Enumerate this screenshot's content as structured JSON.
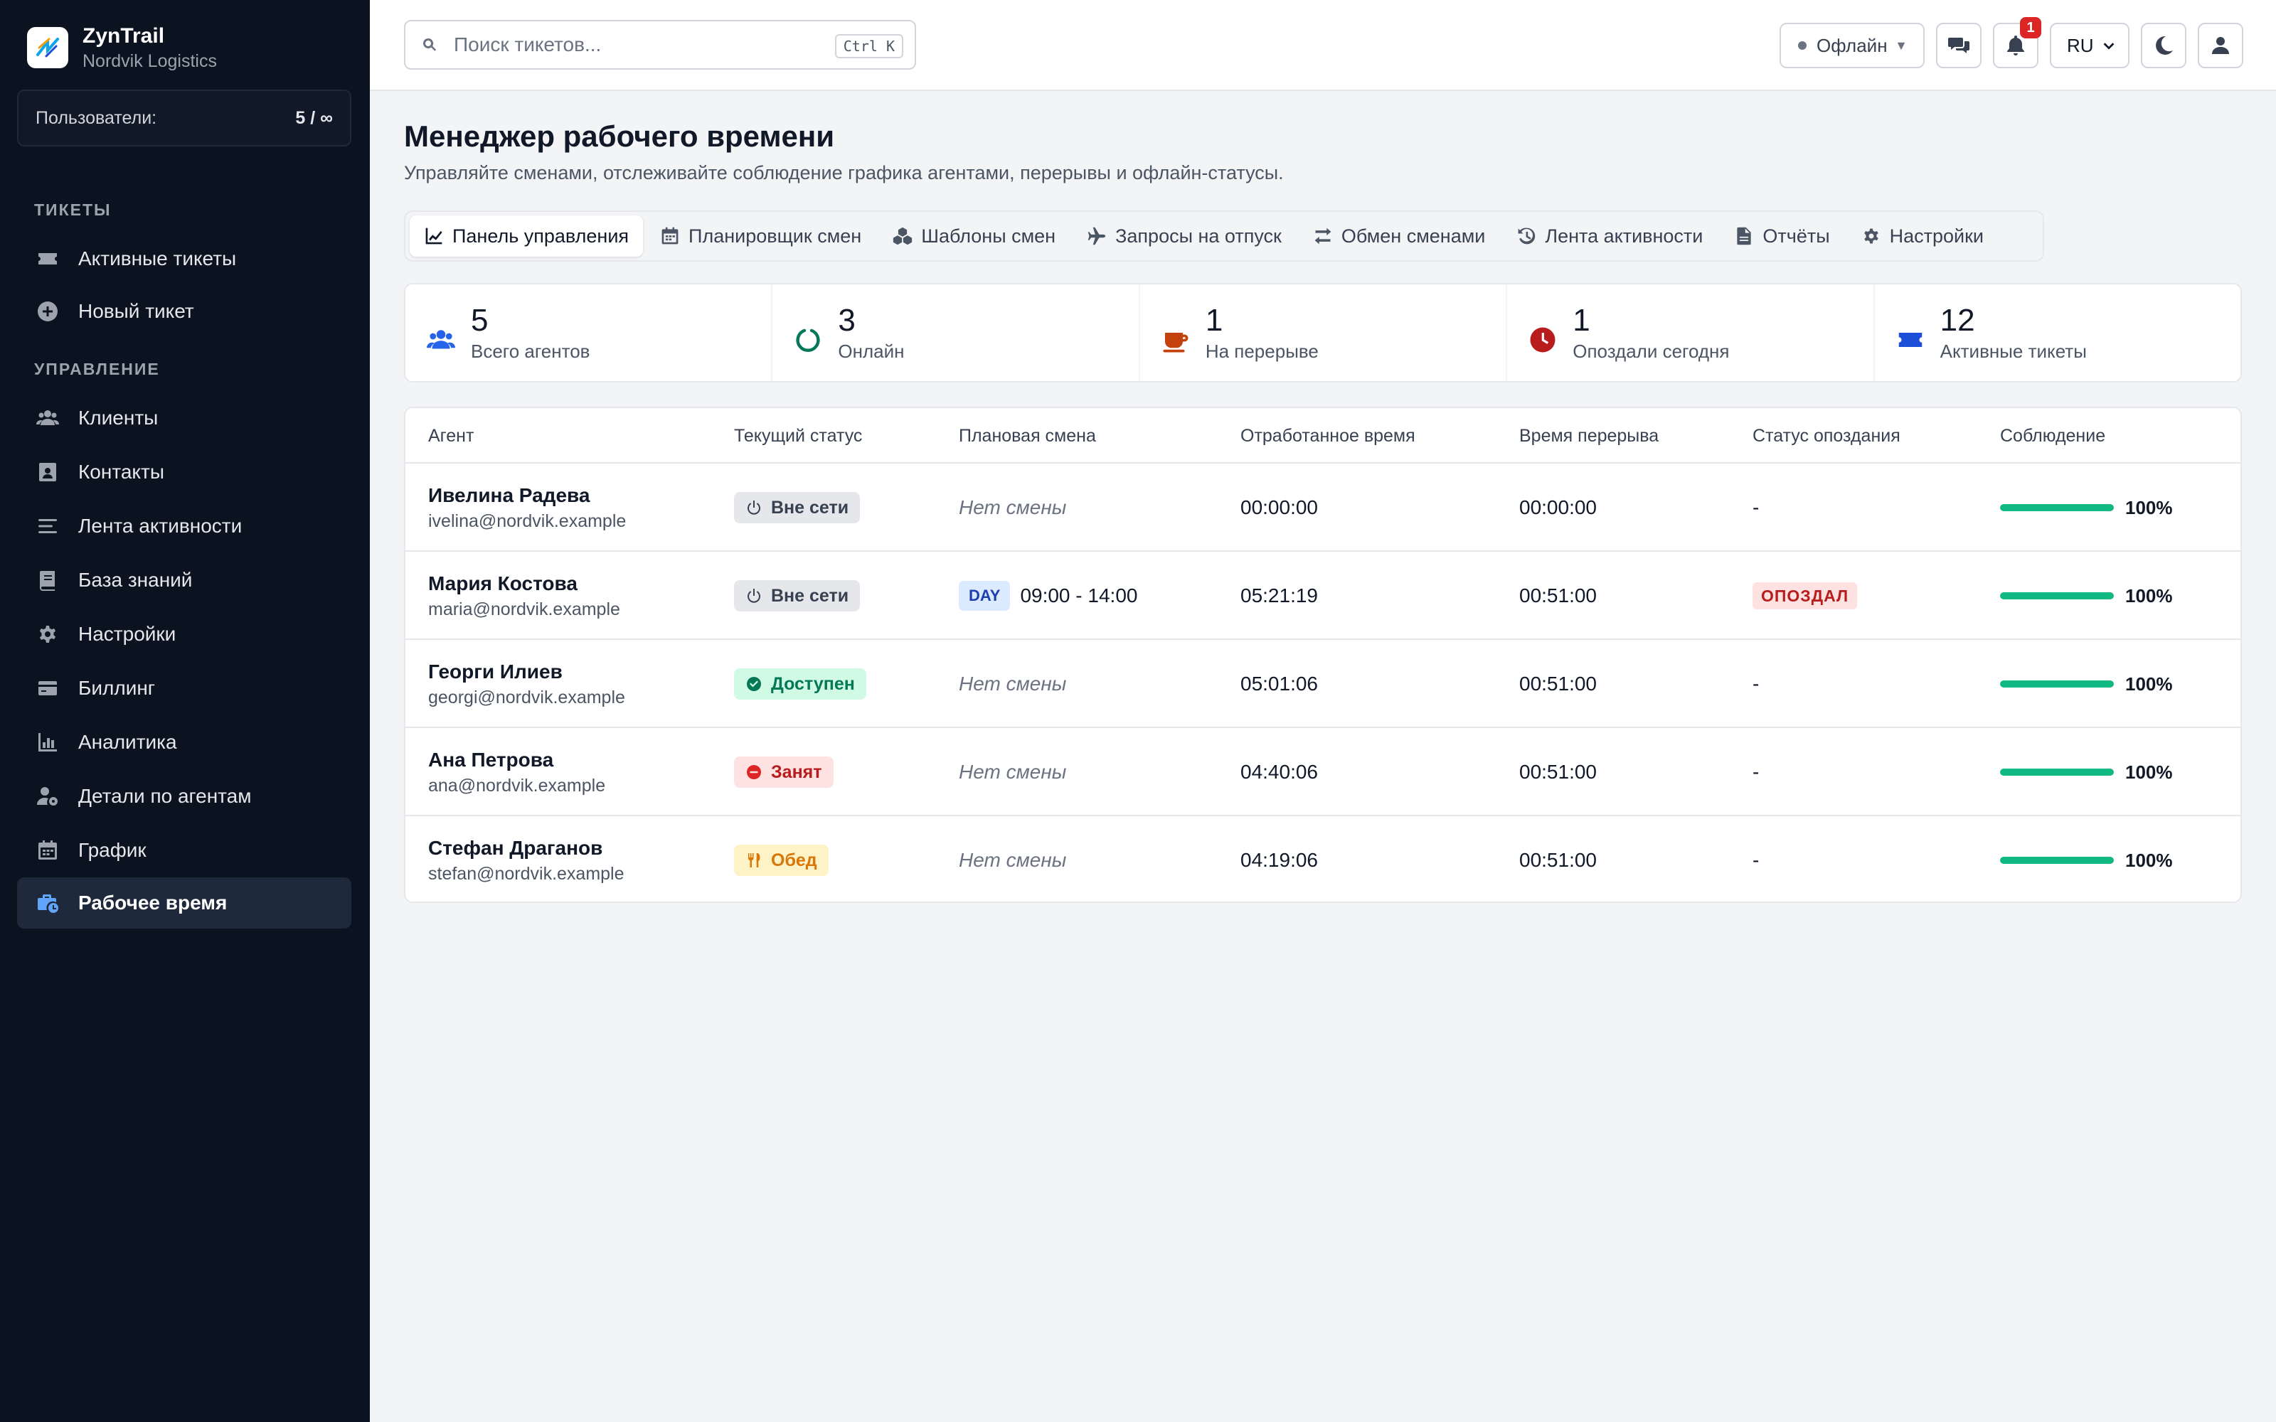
{
  "brand": {
    "name": "ZynTrail",
    "org": "Nordvik Logistics"
  },
  "users": {
    "label": "Пользователи:",
    "count": "5 / ∞"
  },
  "sidebar": {
    "section_tickets": "ТИКЕТЫ",
    "section_management": "УПРАВЛЕНИЕ",
    "tickets": [
      {
        "label": "Активные тикеты",
        "icon": "ticket-icon"
      },
      {
        "label": "Новый тикет",
        "icon": "plus-circle-icon"
      }
    ],
    "management": [
      {
        "label": "Клиенты",
        "icon": "users-icon"
      },
      {
        "label": "Контакты",
        "icon": "contact-card-icon"
      },
      {
        "label": "Лента активности",
        "icon": "list-icon"
      },
      {
        "label": "База знаний",
        "icon": "book-icon"
      },
      {
        "label": "Настройки",
        "icon": "gear-icon"
      },
      {
        "label": "Биллинг",
        "icon": "credit-card-icon"
      },
      {
        "label": "Аналитика",
        "icon": "chart-icon"
      },
      {
        "label": "Детали по агентам",
        "icon": "user-gear-icon"
      },
      {
        "label": "График",
        "icon": "calendar-icon"
      },
      {
        "label": "Рабочее время",
        "icon": "business-time-icon",
        "active": true
      }
    ]
  },
  "topbar": {
    "search_placeholder": "Поиск тикетов...",
    "search_shortcut": "Ctrl K",
    "status_value": "Офлайн",
    "notifications_count": "1",
    "language": "RU"
  },
  "page": {
    "title": "Менеджер рабочего времени",
    "subtitle": "Управляйте сменами, отслеживайте соблюдение графика агентами, перерывы и офлайн-статусы."
  },
  "tabs": [
    {
      "label": "Панель управления",
      "icon": "chart-line-icon",
      "active": true
    },
    {
      "label": "Планировщик смен",
      "icon": "calendar-icon"
    },
    {
      "label": "Шаблоны смен",
      "icon": "cubes-icon"
    },
    {
      "label": "Запросы на отпуск",
      "icon": "plane-icon"
    },
    {
      "label": "Обмен сменами",
      "icon": "swap-icon"
    },
    {
      "label": "Лента активности",
      "icon": "history-icon"
    },
    {
      "label": "Отчёты",
      "icon": "file-icon"
    },
    {
      "label": "Настройки",
      "icon": "gear-icon"
    }
  ],
  "stats": [
    {
      "value": "5",
      "label": "Всего агентов",
      "icon": "users-icon",
      "color": "#2563eb"
    },
    {
      "value": "3",
      "label": "Онлайн",
      "icon": "circle-notch-icon",
      "color": "#047857"
    },
    {
      "value": "1",
      "label": "На перерыве",
      "icon": "coffee-icon",
      "color": "#c2410c"
    },
    {
      "value": "1",
      "label": "Опоздали сегодня",
      "icon": "clock-icon",
      "color": "#b91c1c"
    },
    {
      "value": "12",
      "label": "Активные тикеты",
      "icon": "ticket-icon",
      "color": "#1d4ed8"
    }
  ],
  "table": {
    "headers": [
      "Агент",
      "Текущий статус",
      "Плановая смена",
      "Отработанное время",
      "Время перерыва",
      "Статус опоздания",
      "Соблюдение"
    ],
    "rows": [
      {
        "name": "Ивелина Радева",
        "email": "ivelina@nordvik.example",
        "status": "Вне сети",
        "status_type": "offline",
        "shift_tag": "",
        "shift": "Нет смены",
        "worked": "00:00:00",
        "break": "00:00:00",
        "late": "-",
        "compliance": "100%",
        "compliance_value": 1.0
      },
      {
        "name": "Мария Костова",
        "email": "maria@nordvik.example",
        "status": "Вне сети",
        "status_type": "offline",
        "shift_tag": "DAY",
        "shift": "09:00 - 14:00",
        "worked": "05:21:19",
        "break": "00:51:00",
        "late": "ОПОЗДАЛ",
        "compliance": "100%",
        "compliance_value": 1.0
      },
      {
        "name": "Георги Илиев",
        "email": "georgi@nordvik.example",
        "status": "Доступен",
        "status_type": "available",
        "shift_tag": "",
        "shift": "Нет смены",
        "worked": "05:01:06",
        "break": "00:51:00",
        "late": "-",
        "compliance": "100%",
        "compliance_value": 1.0
      },
      {
        "name": "Ана Петрова",
        "email": "ana@nordvik.example",
        "status": "Занят",
        "status_type": "busy",
        "shift_tag": "",
        "shift": "Нет смены",
        "worked": "04:40:06",
        "break": "00:51:00",
        "late": "-",
        "compliance": "100%",
        "compliance_value": 1.0
      },
      {
        "name": "Стефан Драганов",
        "email": "stefan@nordvik.example",
        "status": "Обед",
        "status_type": "lunch",
        "shift_tag": "",
        "shift": "Нет смены",
        "worked": "04:19:06",
        "break": "00:51:00",
        "late": "-",
        "compliance": "100%",
        "compliance_value": 1.0
      }
    ]
  }
}
